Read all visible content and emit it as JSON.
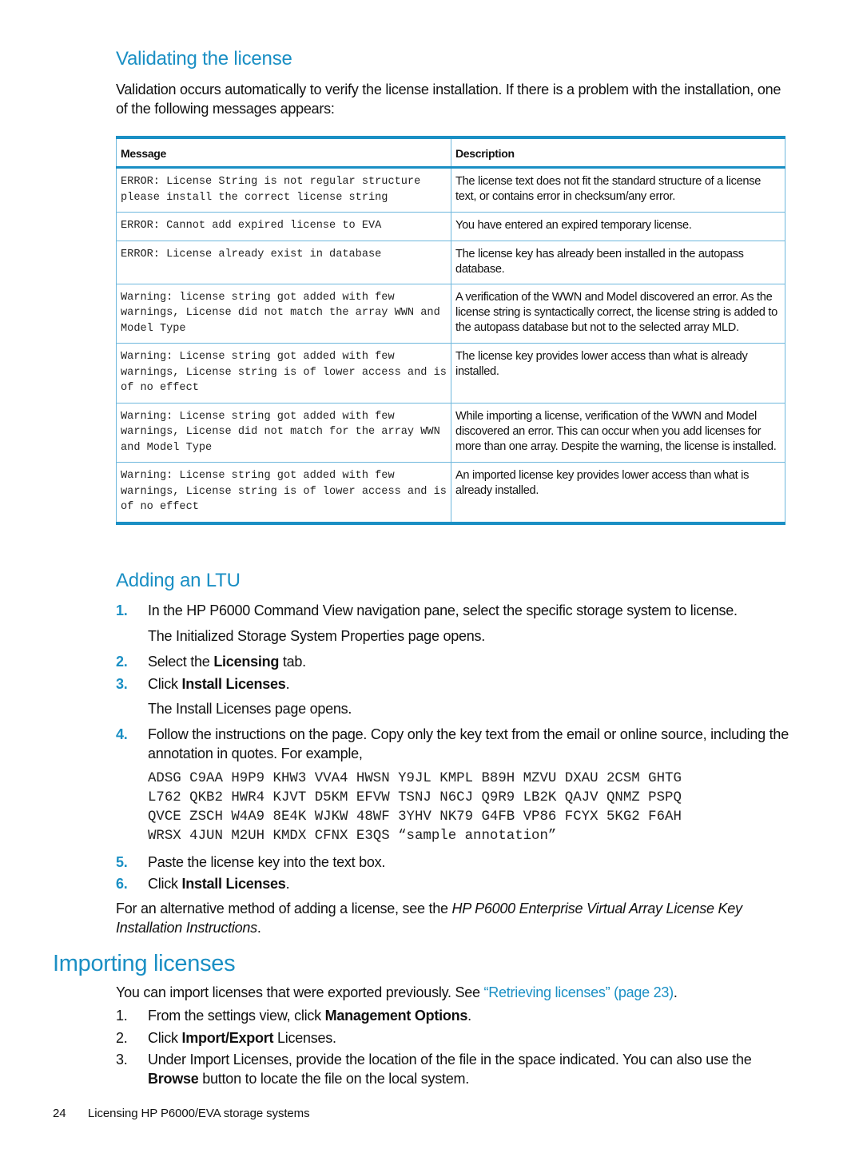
{
  "section_validating": {
    "title": "Validating the license",
    "intro": "Validation occurs automatically to verify the license installation. If there is a problem with the installation, one of the following messages appears:",
    "table": {
      "headers": [
        "Message",
        "Description"
      ],
      "rows": [
        {
          "message": "ERROR: License String is not regular structure please install the correct license string",
          "description": "The license text does not fit the standard structure of a license text, or contains error in checksum/any error."
        },
        {
          "message": "ERROR: Cannot add expired license to EVA",
          "description": "You have entered an expired temporary license."
        },
        {
          "message": "ERROR: License already exist in database",
          "description": "The license key has already been installed in the autopass database."
        },
        {
          "message": "Warning: license string got added with few warnings, License did not match the array WWN and Model Type",
          "description": "A verification of the WWN and Model discovered an error. As the license string is syntactically correct, the license string is added to the autopass database but not to the selected array MLD."
        },
        {
          "message": "Warning: License string got added with few warnings, License string is of lower access and is of no effect",
          "description": "The license key provides lower access than what is already installed."
        },
        {
          "message": "Warning: License string got added with few warnings, License did not match for the array WWN and Model Type",
          "description": "While importing a license, verification of the WWN and Model discovered an error. This can occur when you add licenses for more than one array. Despite the warning, the license is installed."
        },
        {
          "message": "Warning: License string got added with few warnings, License string is of lower access and is of no effect",
          "description": "An imported license key provides lower access than what is already installed."
        }
      ]
    }
  },
  "section_adding": {
    "title": "Adding an LTU",
    "steps": [
      {
        "num": "1.",
        "pre": "In the HP P6000 Command View navigation pane, select the specific storage system to license.",
        "result": "The Initialized Storage System Properties page opens."
      },
      {
        "num": "2.",
        "pre": "Select the ",
        "bold": "Licensing",
        "post": " tab."
      },
      {
        "num": "3.",
        "pre": "Click ",
        "bold": "Install Licenses",
        "post": ".",
        "result": "The Install Licenses page opens."
      },
      {
        "num": "4.",
        "pre": "Follow the instructions on the page. Copy only the key text from the email or online source, including the annotation in quotes. For example,"
      },
      {
        "num": "5.",
        "pre": "Paste the license key into the text box."
      },
      {
        "num": "6.",
        "pre": "Click ",
        "bold": "Install Licenses",
        "post": "."
      }
    ],
    "license_key_lines": [
      "ADSG C9AA H9P9 KHW3 VVA4 HWSN Y9JL KMPL B89H MZVU DXAU 2CSM GHTG",
      "L762 QKB2 HWR4 KJVT D5KM EFVW TSNJ N6CJ Q9R9 LB2K QAJV QNMZ PSPQ",
      "QVCE ZSCH W4A9 8E4K WJKW 48WF 3YHV NK79 G4FB VP86 FCYX 5KG2 F6AH",
      "WRSX 4JUN M2UH KMDX CFNX E3QS “sample annotation”"
    ],
    "alt_pre": "For an alternative method of adding a license, see the ",
    "alt_italic": "HP P6000 Enterprise Virtual Array License Key Installation Instructions",
    "alt_post": "."
  },
  "section_importing": {
    "title": "Importing licenses",
    "intro_pre": "You can import licenses that were exported previously. See ",
    "intro_link": "“Retrieving licenses” (page 23)",
    "intro_post": ".",
    "steps": [
      {
        "num": "1.",
        "pre": "From the settings view, click ",
        "bold": "Management Options",
        "post": "."
      },
      {
        "num": "2.",
        "pre": "Click ",
        "bold": "Import/Export",
        "post": " Licenses."
      },
      {
        "num": "3.",
        "pre": "Under Import Licenses, provide the location of the file in the space indicated. You can also use the ",
        "bold": "Browse",
        "post": " button to locate the file on the local system."
      }
    ]
  },
  "footer": {
    "page_number": "24",
    "chapter": "Licensing HP P6000/EVA storage systems"
  },
  "colors": {
    "accent": "#1a8fc4",
    "table_rule": "#6fb8dd"
  }
}
